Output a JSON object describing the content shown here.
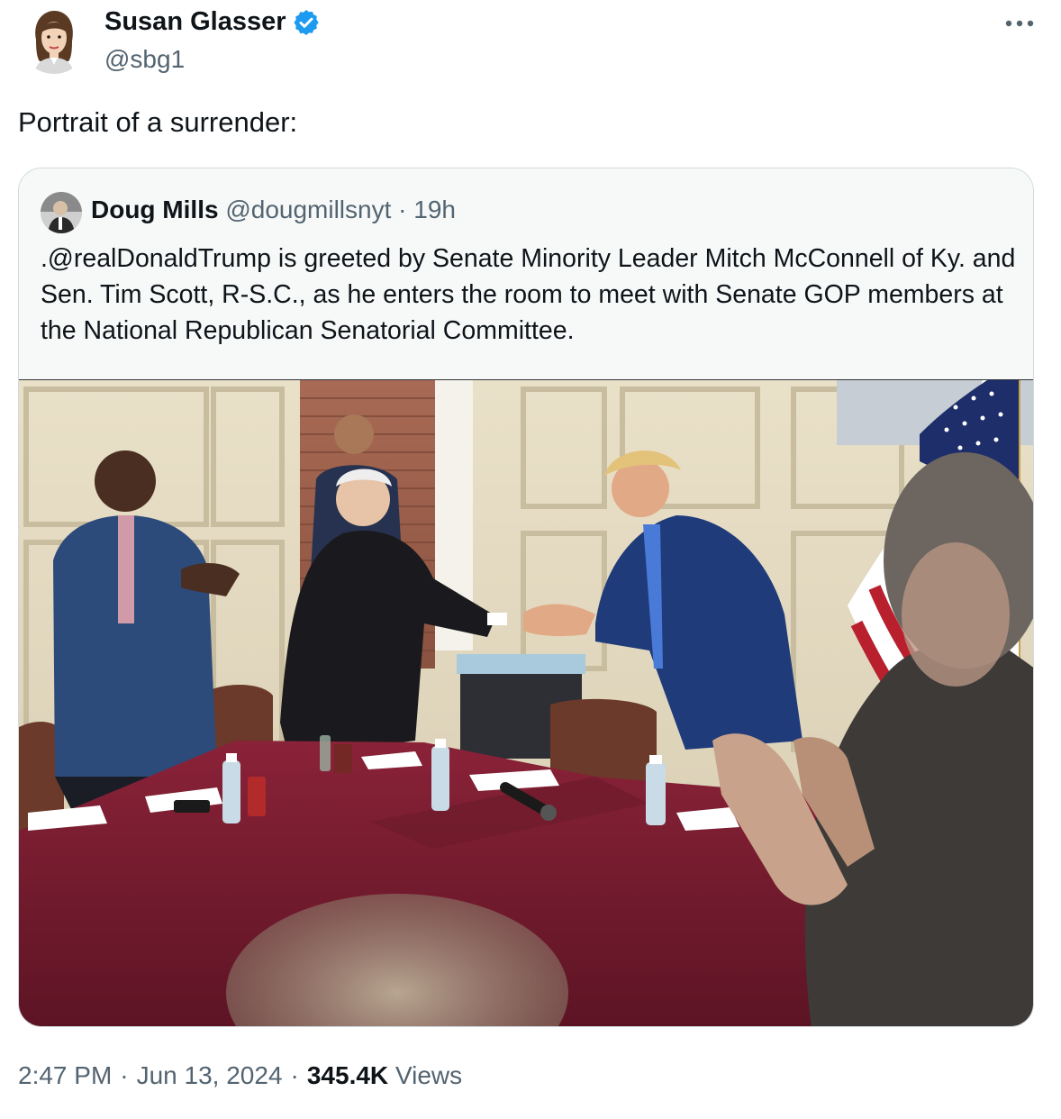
{
  "tweet": {
    "author_name": "Susan Glasser",
    "author_handle": "@sbg1",
    "text": "Portrait of a surrender:",
    "time": "2:47 PM",
    "date": "Jun 13, 2024",
    "views_count": "345.4K",
    "views_label": "Views",
    "separator": "·"
  },
  "quote": {
    "author_name": "Doug Mills",
    "author_handle": "@dougmillsnyt",
    "separator": "·",
    "age": "19h",
    "text": ".@realDonaldTrump is greeted by Senate Minority Leader Mitch McConnell of Ky. and Sen. Tim Scott, R-S.C., as he enters the room to meet with Senate GOP members at the National Republican Senatorial Committee."
  },
  "colors": {
    "text_primary": "#0f1419",
    "text_secondary": "#536471",
    "verified_badge": "#1d9bf0",
    "card_border": "#cfd9de",
    "card_header_bg": "#f7f9f9",
    "tablecloth": "#7a1e30"
  },
  "icons": {
    "verified": "verified-badge-icon",
    "more": "more-options-icon"
  }
}
